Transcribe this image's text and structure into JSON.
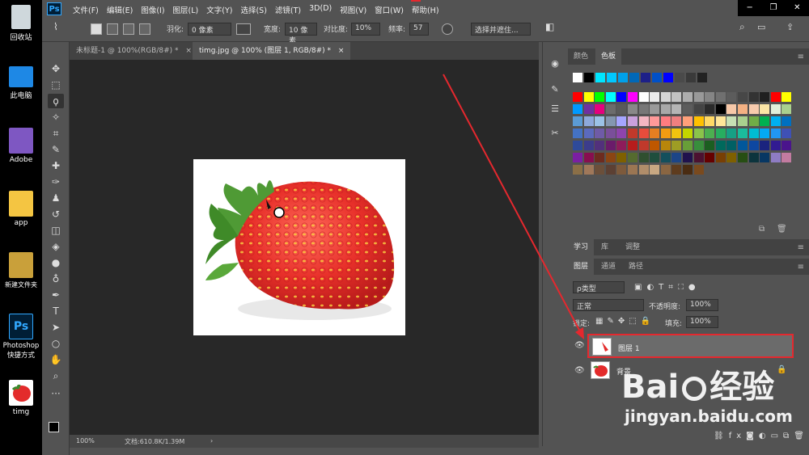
{
  "desktop": {
    "icons": [
      {
        "label": "回收站",
        "icon": "recycle-bin-icon"
      },
      {
        "label": "此电脑",
        "icon": "computer-icon"
      },
      {
        "label": "Adobe",
        "icon": "folder-icon"
      },
      {
        "label": "app",
        "icon": "folder-icon"
      },
      {
        "label": "新建文件夹",
        "icon": "folder-icon"
      },
      {
        "label": "Photoshop 快捷方式",
        "icon": "photoshop-shortcut-icon"
      },
      {
        "label": "timg",
        "icon": "image-file-icon"
      }
    ]
  },
  "app": {
    "logo": "Ps",
    "menus": [
      "文件(F)",
      "编辑(E)",
      "图像(I)",
      "图层(L)",
      "文字(Y)",
      "选择(S)",
      "滤镜(T)",
      "3D(D)",
      "视图(V)",
      "窗口(W)",
      "帮助(H)"
    ],
    "window_controls": [
      "−",
      "❐",
      "✕"
    ]
  },
  "options": {
    "feather_label": "羽化:",
    "feather_value": "0 像素",
    "width_label": "宽度:",
    "width_value": "10 像素",
    "contrast_label": "对比度:",
    "contrast_value": "10%",
    "frequency_label": "频率:",
    "frequency_value": "57",
    "select_mask_button": "选择并遮住..."
  },
  "tabs": [
    {
      "label": "未标题-1 @ 100%(RGB/8#) *",
      "close": "×"
    },
    {
      "label": "timg.jpg @ 100% (图层 1, RGB/8#) *",
      "close": "×"
    }
  ],
  "status": {
    "zoom": "100%",
    "doc_size": "文档:610.8K/1.39M",
    "arrow": "›"
  },
  "color_panel": {
    "tabs": [
      "颜色",
      "色板"
    ],
    "recent_swatches": [
      "#ffffff",
      "#000000",
      "#00e5ff",
      "#00c8ff",
      "#00a0e9",
      "#0068b7",
      "#1d2088",
      "#0050c8",
      "#0000ff",
      "#4a4a4a",
      "#3a3a3a",
      "#222222"
    ],
    "swatch_rows": [
      [
        "#ff0000",
        "#ffff00",
        "#00ff00",
        "#00ffff",
        "#0000ff",
        "#ff00ff",
        "#ffffff",
        "#ebebeb",
        "#d6d6d6",
        "#c2c2c2",
        "#adadad",
        "#999999",
        "#858585",
        "#707070",
        "#5c5c5c",
        "#474747",
        "#333333",
        "#1f1f1f",
        "#ff0000",
        "#ffff00"
      ],
      [
        "#0099ff",
        "#7030a0",
        "#e6007e",
        "#6c6c6c",
        "#5a5a5a",
        "#888888",
        "#777777",
        "#9a9a9a",
        "#a8a8a8",
        "#b5b5b5",
        "#5c5c5c",
        "#444444",
        "#2a2a2a",
        "#000000",
        "#f7c8a8",
        "#f4b183",
        "#f8cbad",
        "#fbe5a5",
        "#e2efda",
        "#a9d08e"
      ],
      [
        "#5b9bd5",
        "#8ea9db",
        "#9bc2e6",
        "#8497b0",
        "#a5a5ff",
        "#c9a0dc",
        "#f4b6c2",
        "#ff9999",
        "#ff7c80",
        "#f08080",
        "#ffa07a",
        "#ffc000",
        "#ffd966",
        "#ffe699",
        "#c6e0b4",
        "#a9d08e",
        "#70ad47",
        "#00b050",
        "#00b0f0",
        "#0070c0"
      ],
      [
        "#4472c4",
        "#5b6abf",
        "#6f5ba7",
        "#7a4f9a",
        "#8e44ad",
        "#c0392b",
        "#e74c3c",
        "#e67e22",
        "#f39c12",
        "#f1c40f",
        "#c3d600",
        "#8bc34a",
        "#4caf50",
        "#27ae60",
        "#16a085",
        "#1abc9c",
        "#00bcd4",
        "#03a9f4",
        "#2196f3",
        "#3f51b5"
      ],
      [
        "#2e4a9a",
        "#3c3c8c",
        "#52307c",
        "#6a1b6a",
        "#8e1b5a",
        "#b71c1c",
        "#c0392b",
        "#bf5700",
        "#b8860b",
        "#9e9d24",
        "#689f38",
        "#388e3c",
        "#1b5e20",
        "#00695c",
        "#006064",
        "#01579b",
        "#0d47a1",
        "#1a237e",
        "#311b92",
        "#4a148c"
      ],
      [
        "#7b1fa2",
        "#880e4f",
        "#6d2b1f",
        "#8b4513",
        "#7f6000",
        "#556b2f",
        "#2f4f2f",
        "#1f4e3d",
        "#134f5c",
        "#1c4587",
        "#20124d",
        "#4c1130",
        "#660000",
        "#783f04",
        "#7f6000",
        "#274e13",
        "#0c343d",
        "#073763",
        "#8e7cc3",
        "#c27ba0"
      ],
      [
        "#8b6f47",
        "#a0785a",
        "#6b4f3a",
        "#5c4033",
        "#7d5a3c",
        "#9b7653",
        "#b08d6a",
        "#c8a882",
        "#8a6642",
        "#5e3c1e",
        "#4a2c12",
        "#7a4a1e"
      ]
    ]
  },
  "layers_panel": {
    "top_tabs": [
      "学习",
      "库",
      "调整"
    ],
    "tabs": [
      "图层",
      "通道",
      "路径"
    ],
    "filter_label": "ρ类型",
    "blend_mode": "正常",
    "opacity_label": "不透明度:",
    "opacity_value": "100%",
    "lock_label": "锁定:",
    "fill_label": "填充:",
    "fill_value": "100%",
    "layers": [
      {
        "name": "图层 1",
        "selected": true
      },
      {
        "name": "背景",
        "selected": false
      }
    ],
    "footer_icons": [
      "link-icon",
      "fx-icon",
      "mask-icon",
      "adjustment-icon",
      "folder-icon",
      "new-layer-icon",
      "trash-icon"
    ]
  },
  "watermark": {
    "brand": "Bai",
    "brand2": "经验",
    "url": "jingyan.baidu.com"
  },
  "colors": {
    "annotation_red": "#e5282e",
    "accent_blue": "#31a8ff"
  }
}
